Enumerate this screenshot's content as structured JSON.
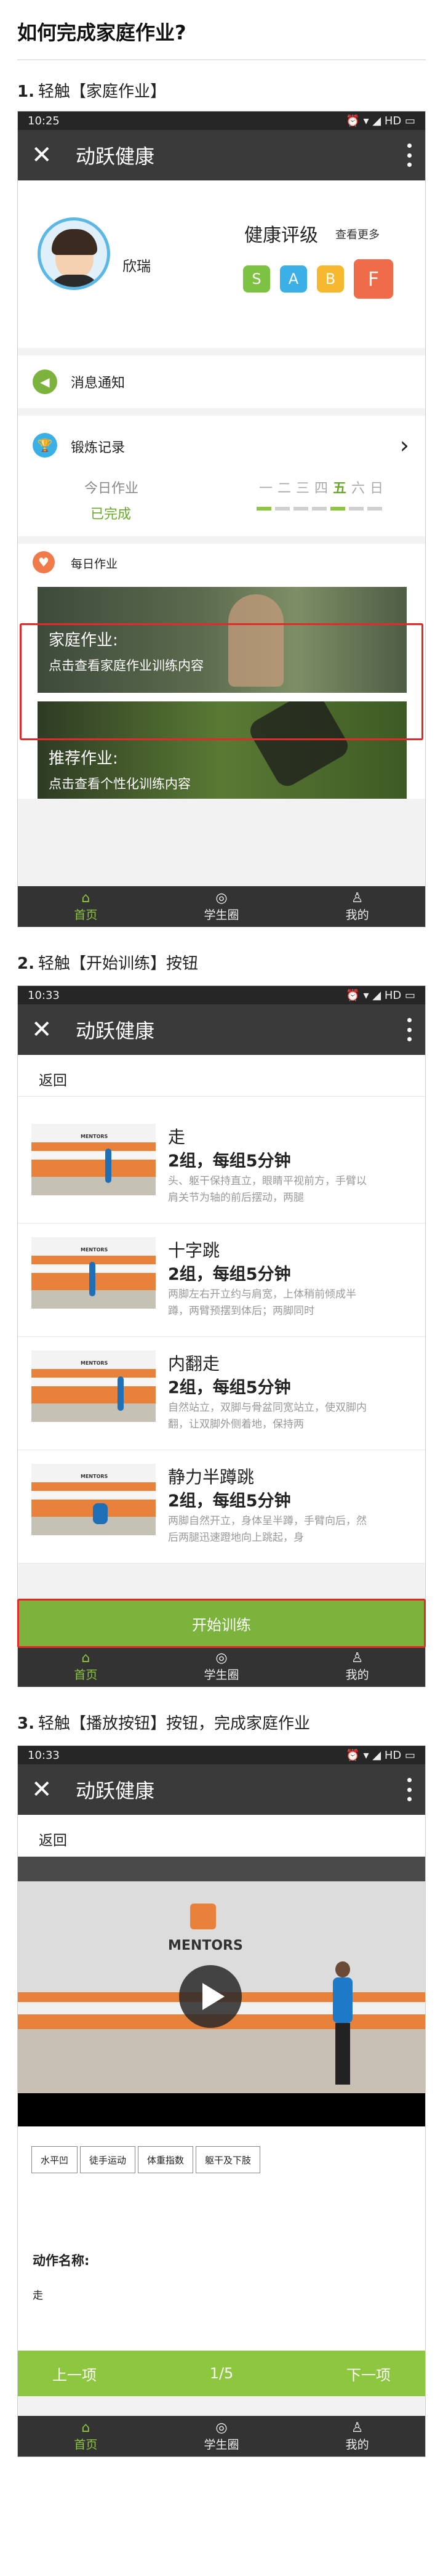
{
  "page": {
    "title": "如何完成家庭作业?"
  },
  "steps": [
    {
      "num": "1.",
      "text": "轻触【家庭作业】"
    },
    {
      "num": "2.",
      "text": "轻触【开始训练】按钮"
    },
    {
      "num": "3.",
      "text": "轻触【播放按钮】按钮，完成家庭作业"
    }
  ],
  "screens": [
    {
      "time": "10:25",
      "status_right": "⏰ ▾ ◢ HD ▭"
    },
    {
      "time": "10:33",
      "status_right": "⏰ ▾ ◢ HD ▭"
    },
    {
      "time": "10:33",
      "status_right": "⏰ ▾ ◢ HD ▭"
    }
  ],
  "app": {
    "title": "动跃健康"
  },
  "tabbar": {
    "home": "首页",
    "circle": "学生圈",
    "me": "我的"
  },
  "home": {
    "username": "欣瑞",
    "grade_label": "健康评级",
    "grade_more": "查看更多",
    "badges": [
      {
        "letter": "S",
        "color": "#7dc242"
      },
      {
        "letter": "A",
        "color": "#3ab0e6"
      },
      {
        "letter": "B",
        "color": "#f5b82e"
      },
      {
        "letter": "F",
        "color": "#ef6b4a"
      }
    ],
    "messages": "消息通知",
    "training_record": "锻炼记录",
    "today_label": "今日作业",
    "today_status": "已完成",
    "weekdays": [
      "一",
      "二",
      "三",
      "四",
      "五",
      "六",
      "日"
    ],
    "weekday_highlight": 4,
    "bars": [
      true,
      false,
      false,
      false,
      true,
      false,
      false
    ],
    "daily_label": "每日作业",
    "homework_title": "家庭作业:",
    "homework_sub": "点击查看家庭作业训练内容",
    "recommend_title": "推荐作业:",
    "recommend_sub": "点击查看个性化训练内容"
  },
  "list": {
    "back": "返回",
    "start_button": "开始训练",
    "items": [
      {
        "name": "走",
        "sets": "2组，每组5分钟",
        "desc": "头、躯干保持直立，眼睛平视前方，手臂以肩关节为轴的前后摆动，两腿"
      },
      {
        "name": "十字跳",
        "sets": "2组，每组5分钟",
        "desc": "两脚左右开立约与肩宽，上体稍前倾成半蹲，两臂预摆到体后；两脚同时"
      },
      {
        "name": "内翻走",
        "sets": "2组，每组5分钟",
        "desc": "自然站立，双脚与骨盆同宽站立，使双脚内翻，让双脚外侧着地，保持两"
      },
      {
        "name": "静力半蹲跳",
        "sets": "2组，每组5分钟",
        "desc": "两脚自然开立，身体呈半蹲，手臂向后，然后两腿迅速蹬地向上跳起，身"
      }
    ]
  },
  "player": {
    "back": "返回",
    "video_logo": "MENTORS",
    "chips": [
      "水平凹",
      "徒手运动",
      "体重指数",
      "躯干及下肢"
    ],
    "action_label": "动作名称:",
    "action_value": "走",
    "prev": "上一项",
    "page": "1/5",
    "next": "下一项"
  }
}
